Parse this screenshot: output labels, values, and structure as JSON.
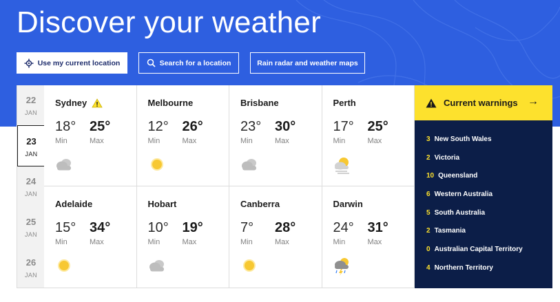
{
  "hero": {
    "title": "Discover your weather",
    "background_color": "#2e5fe0"
  },
  "buttons": {
    "location": {
      "label": "Use my current location",
      "icon": "crosshair-icon"
    },
    "search": {
      "label": "Search for a location",
      "icon": "search-icon"
    },
    "radar": {
      "label": "Rain radar and weather maps"
    }
  },
  "dates": [
    {
      "day": "22",
      "month": "JAN",
      "active": false
    },
    {
      "day": "23",
      "month": "JAN",
      "active": true
    },
    {
      "day": "24",
      "month": "JAN",
      "active": false
    },
    {
      "day": "25",
      "month": "JAN",
      "active": false
    },
    {
      "day": "26",
      "month": "JAN",
      "active": false
    }
  ],
  "labels": {
    "min": "Min",
    "max": "Max"
  },
  "cities": [
    {
      "name": "Sydney",
      "min": "18°",
      "max": "25°",
      "icon": "cloudy-icon",
      "warning": true
    },
    {
      "name": "Melbourne",
      "min": "12°",
      "max": "26°",
      "icon": "sunny-icon",
      "warning": false
    },
    {
      "name": "Brisbane",
      "min": "23°",
      "max": "30°",
      "icon": "cloudy-icon",
      "warning": false
    },
    {
      "name": "Perth",
      "min": "17°",
      "max": "25°",
      "icon": "hazy-sun-icon",
      "warning": false
    },
    {
      "name": "Adelaide",
      "min": "15°",
      "max": "34°",
      "icon": "sunny-icon",
      "warning": false
    },
    {
      "name": "Hobart",
      "min": "10°",
      "max": "19°",
      "icon": "cloudy-icon",
      "warning": false
    },
    {
      "name": "Canberra",
      "min": "7°",
      "max": "28°",
      "icon": "sunny-icon",
      "warning": false
    },
    {
      "name": "Darwin",
      "min": "24°",
      "max": "31°",
      "icon": "storm-icon",
      "warning": false
    }
  ],
  "warnings": {
    "title": "Current warnings",
    "accent_color": "#fde12d",
    "panel_color": "#0c1e48",
    "items": [
      {
        "count": "3",
        "label": "New South Wales"
      },
      {
        "count": "2",
        "label": "Victoria"
      },
      {
        "count": "10",
        "label": "Queensland"
      },
      {
        "count": "6",
        "label": "Western Australia"
      },
      {
        "count": "5",
        "label": "South Australia"
      },
      {
        "count": "2",
        "label": "Tasmania"
      },
      {
        "count": "0",
        "label": "Australian Capital Territory"
      },
      {
        "count": "4",
        "label": "Northern Territory"
      }
    ]
  }
}
